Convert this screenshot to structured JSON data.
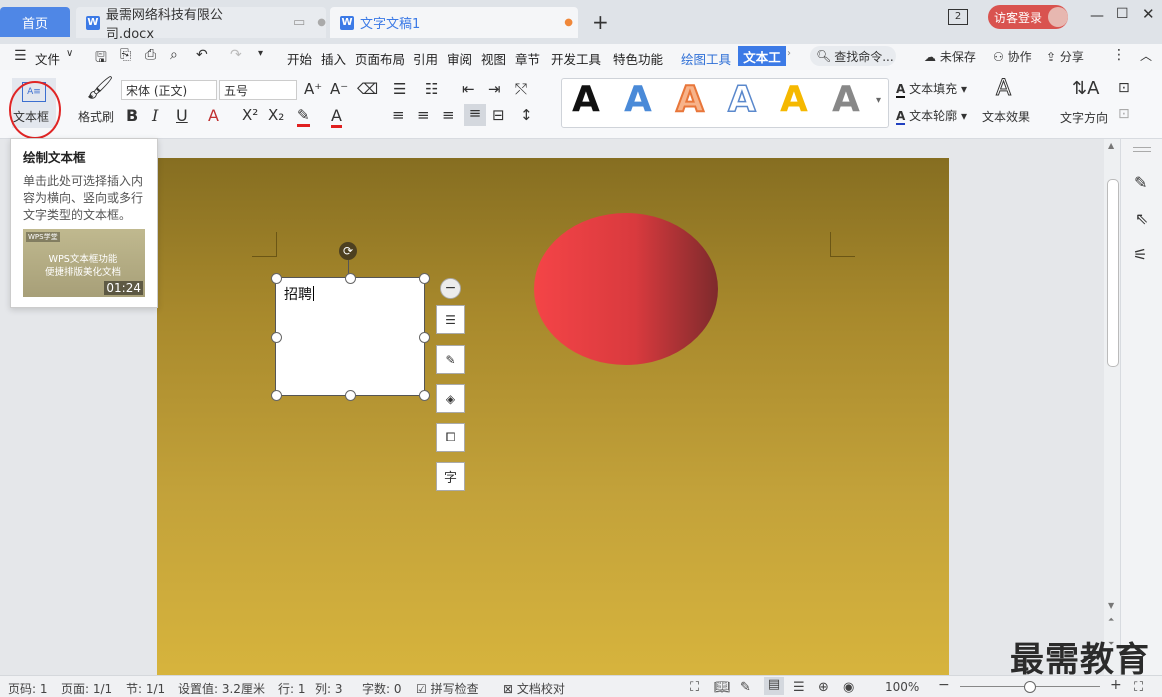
{
  "tabbar": {
    "home_tab": "首页",
    "tabs": [
      {
        "label": "最需网络科技有限公司.docx"
      },
      {
        "label": "文字文稿1"
      }
    ],
    "badge_count": "2",
    "login_label": "访客登录"
  },
  "menu": {
    "file_label": "文件",
    "items": [
      "开始",
      "插入",
      "页面布局",
      "引用",
      "审阅",
      "视图",
      "章节",
      "开发工具",
      "特色功能"
    ],
    "drawing_tools": "绘图工具",
    "text_tools": "文本工",
    "search_placeholder": "查找命令...",
    "unsaved": "未保存",
    "collaborate": "协作",
    "share": "分享"
  },
  "ribbon": {
    "textbox_label": "文本框",
    "format_painter": "格式刷",
    "font_name": "宋体 (正文)",
    "font_size": "五号",
    "text_fill": "文本填充",
    "text_outline": "文本轮廓",
    "text_effect": "文本效果",
    "text_direction": "文字方向",
    "style_letter": "A"
  },
  "tooltip": {
    "title": "绘制文本框",
    "description": "单击此处可选择插入内容为横向、竖向或多行文字类型的文本框。",
    "thumb_logo": "WPS学堂",
    "thumb_line1": "WPS文本框功能",
    "thumb_line2": "便捷排版美化文档",
    "duration": "01:24"
  },
  "document": {
    "textbox_content": "招聘"
  },
  "colors": {
    "accent": "#3c7ae6",
    "page_top": "#866e21",
    "page_bottom": "#d7b43d",
    "ellipse_left": "#f44447",
    "ellipse_right": "#7e2a2c"
  },
  "status": {
    "page_code": "页码: 1",
    "pages": "页面: 1/1",
    "section": "节: 1/1",
    "setting": "设置值: 3.2厘米",
    "row": "行: 1",
    "col": "列: 3",
    "word_count": "字数: 0",
    "spell_check": "拼写检查",
    "doc_proof": "文档校对",
    "zoom": "100%"
  },
  "watermark": "最需教育"
}
